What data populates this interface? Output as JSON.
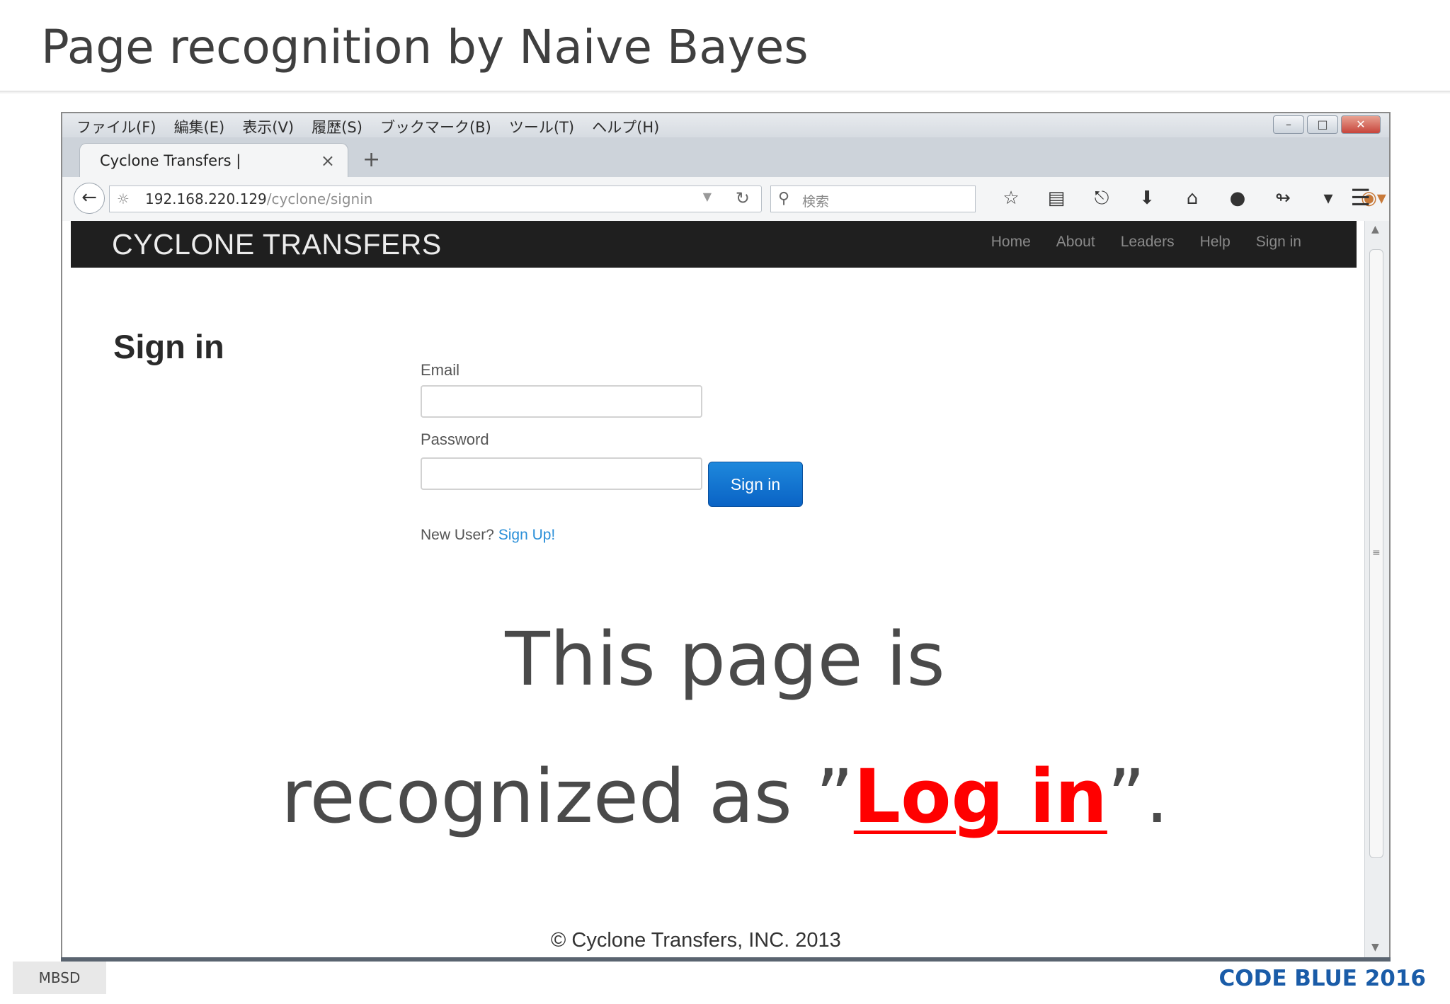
{
  "slide": {
    "title": "Page recognition by Naive Bayes",
    "caption_line1": "This page is",
    "caption_pre": "recognized as ”",
    "caption_highlight": "Log in",
    "caption_post": "”.",
    "accent_color": "#ff0000"
  },
  "browser": {
    "menu": [
      "ファイル(F)",
      "編集(E)",
      "表示(V)",
      "履歴(S)",
      "ブックマーク(B)",
      "ツール(T)",
      "ヘルプ(H)"
    ],
    "tab_title": "Cyclone Transfers |",
    "url_host": "192.168.220.129",
    "url_path": "/cyclone/signin",
    "search_placeholder": "検索",
    "toolbar_icons": [
      "star-icon",
      "clipboard-icon",
      "pocket-icon",
      "download-icon",
      "home-icon",
      "chat-icon",
      "share-icon",
      "dropdown-icon",
      "avatar-icon"
    ]
  },
  "site": {
    "brand": "CYCLONE TRANSFERS",
    "nav": [
      "Home",
      "About",
      "Leaders",
      "Help",
      "Sign in"
    ],
    "heading": "Sign in",
    "email_label": "Email",
    "password_label": "Password",
    "signin_button": "Sign in",
    "new_user_text": "New User?",
    "signup_link": "Sign Up!",
    "footer": "© Cyclone Transfers, INC. 2013"
  },
  "footer": {
    "left_badge": "MBSD",
    "right_brand": "CODE BLUE 2016",
    "brand_color": "#1a5ca8"
  }
}
